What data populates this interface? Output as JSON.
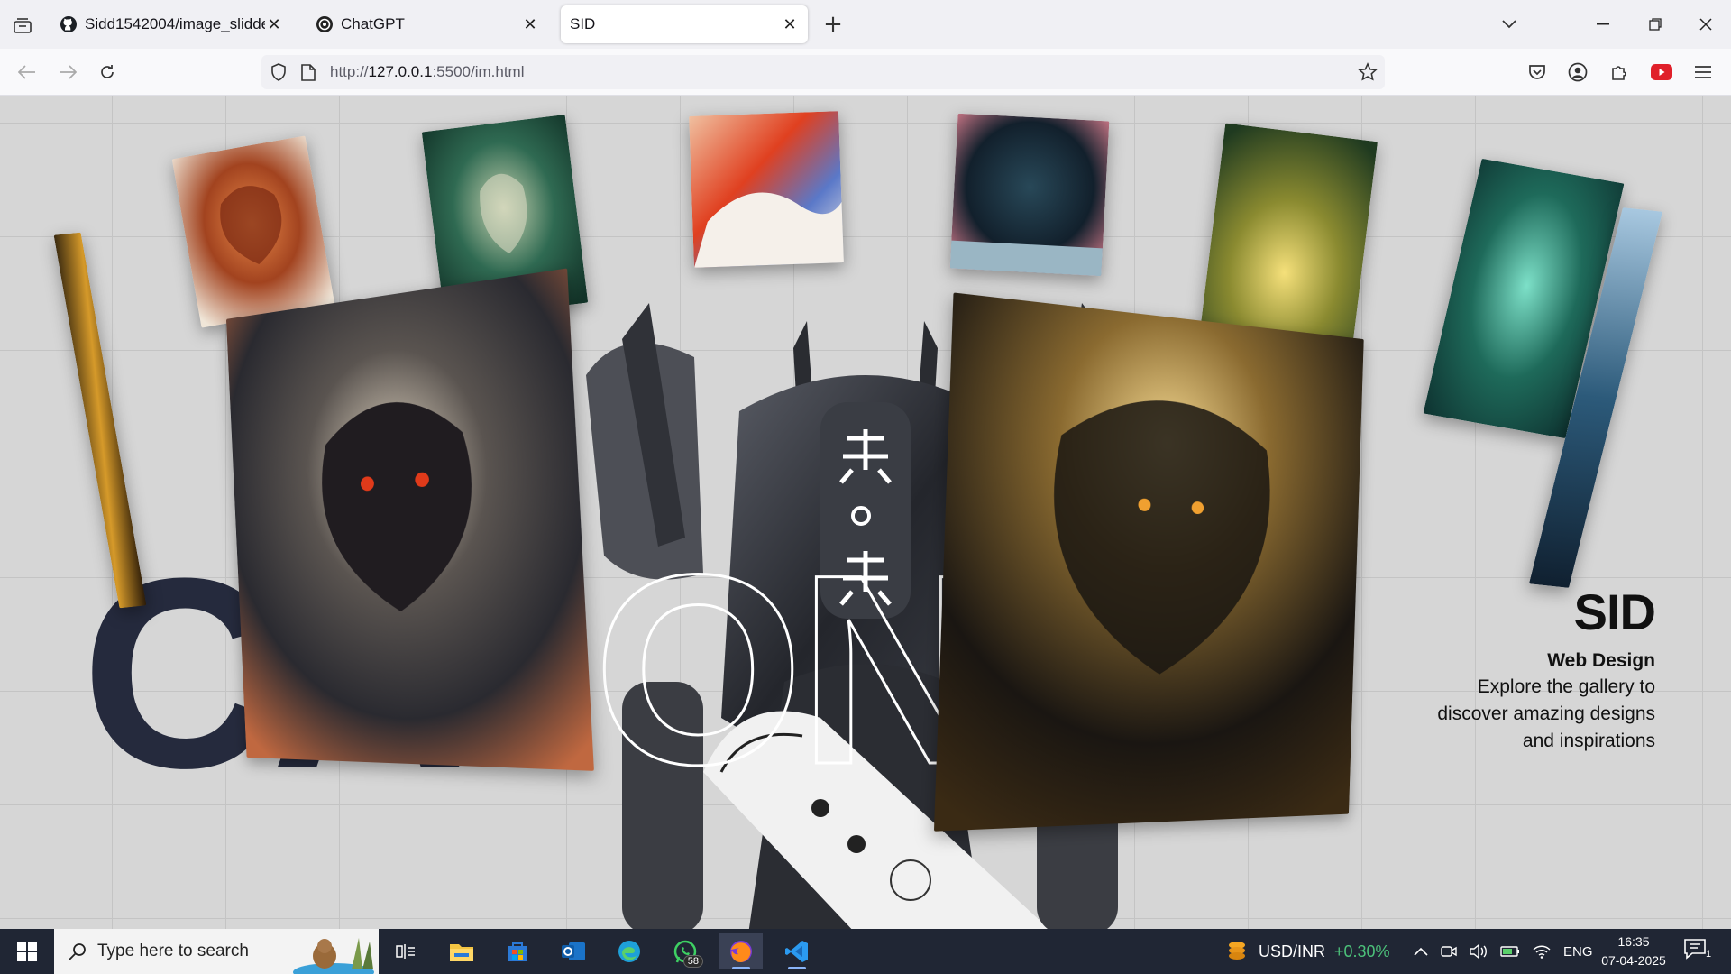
{
  "browser": {
    "tabs": [
      {
        "title": "Sidd1542004/image_slidder",
        "active": false
      },
      {
        "title": "ChatGPT",
        "active": false
      },
      {
        "title": "SID",
        "active": true
      }
    ],
    "url_prefix": "http://",
    "url_host": "127.0.0.1",
    "url_rest": ":5500/im.html"
  },
  "page": {
    "bg_word_left": "CA",
    "bg_word_center": "ON",
    "side_title": "SID",
    "side_subtitle": "Web Design",
    "side_description": "Explore the gallery to discover amazing designs and inspirations",
    "colors": {
      "word": "#252a3d",
      "grid_bg": "#d6d6d6"
    }
  },
  "taskbar": {
    "search_placeholder": "Type here to search",
    "whatsapp_badge": "58",
    "ticker_label": "USD/INR",
    "ticker_change": "+0.30%",
    "language": "ENG",
    "time": "16:35",
    "date": "07-04-2025",
    "notification_count": "1"
  }
}
